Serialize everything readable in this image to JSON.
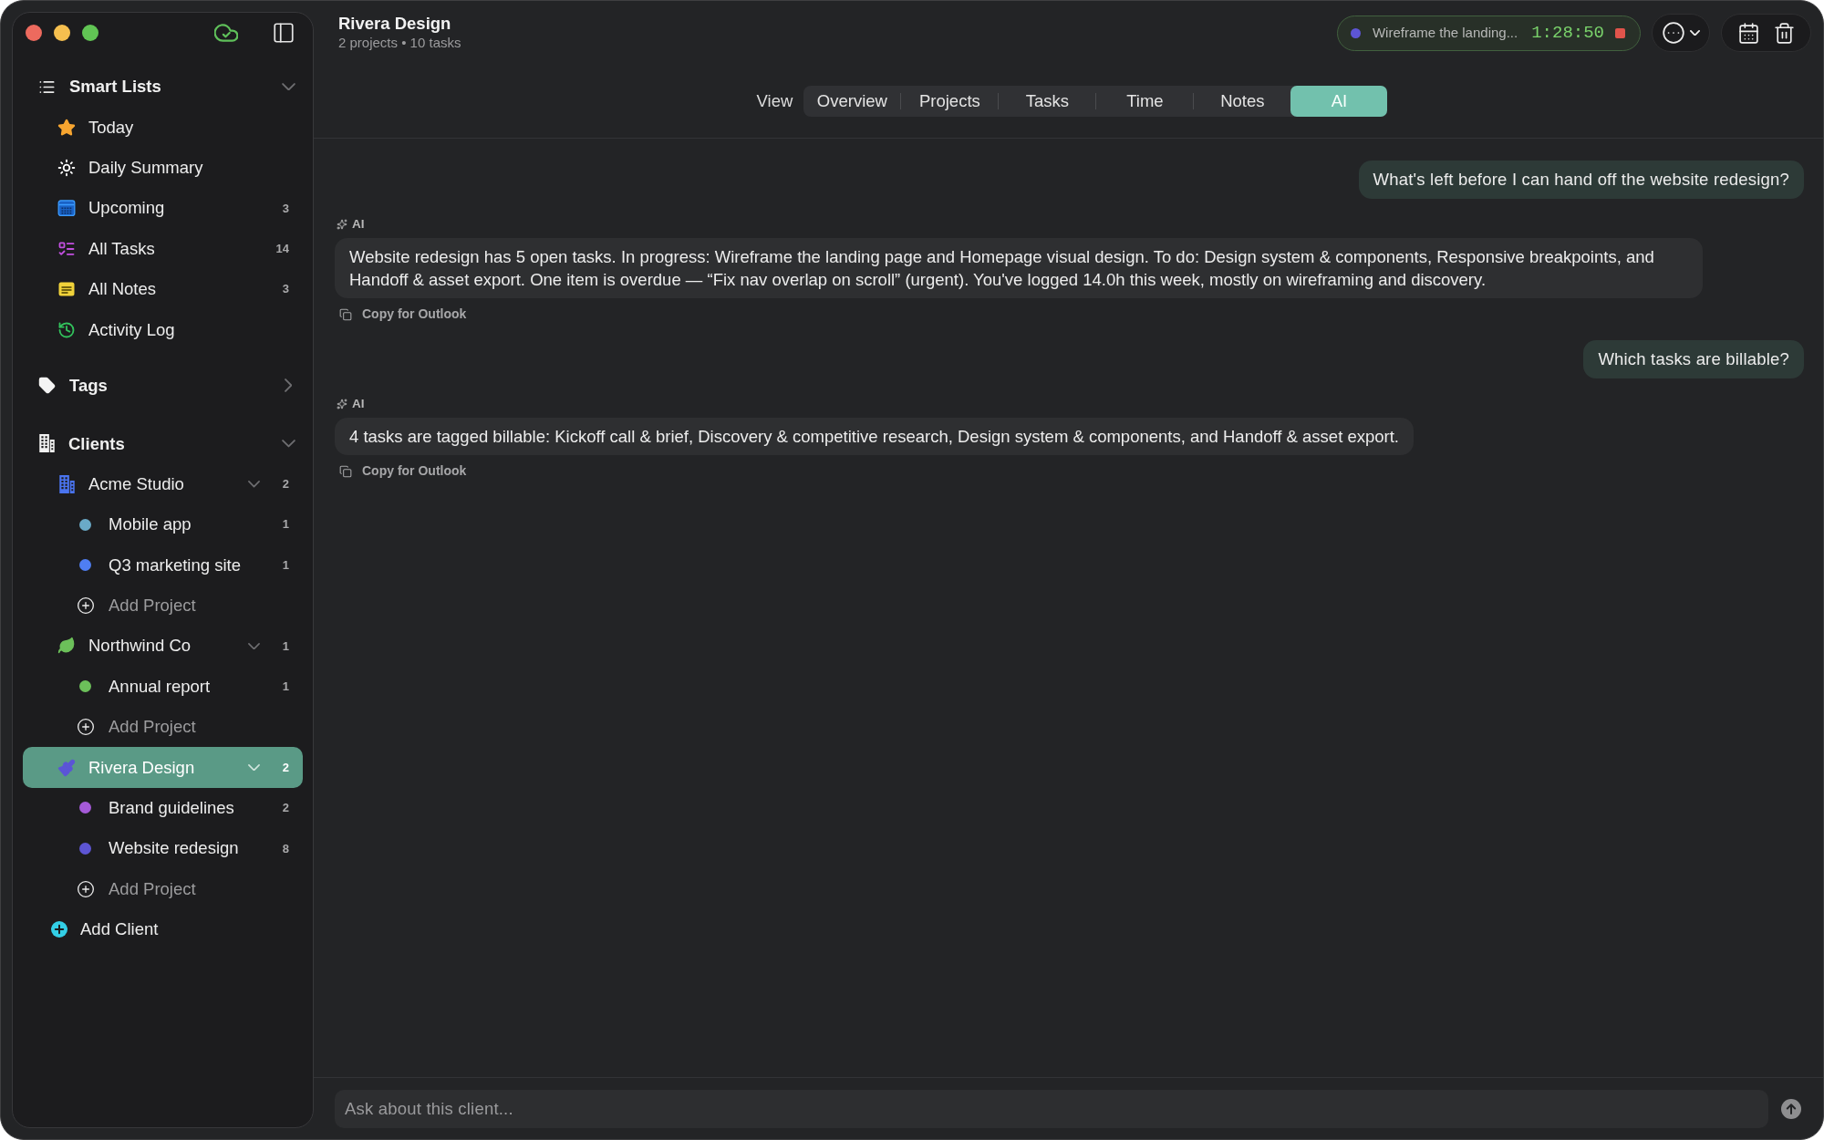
{
  "sidebar": {
    "smart_lists": {
      "title": "Smart Lists",
      "expanded": true,
      "items": [
        {
          "label": "Today",
          "selected": false
        },
        {
          "label": "Daily Summary",
          "selected": false
        },
        {
          "label": "Upcoming",
          "count": "3",
          "selected": false
        },
        {
          "label": "All Tasks",
          "count": "14",
          "selected": false
        },
        {
          "label": "All Notes",
          "count": "3",
          "selected": false
        },
        {
          "label": "Activity Log",
          "selected": false
        }
      ]
    },
    "tags": {
      "title": "Tags",
      "expanded": false
    },
    "clients": {
      "title": "Clients",
      "expanded": true,
      "items": [
        {
          "name": "Acme Studio",
          "count": "2",
          "expanded": true,
          "selected": false,
          "projects": [
            {
              "name": "Mobile app",
              "count": "1",
              "color": "#6aaac8",
              "selected": false
            },
            {
              "name": "Q3 marketing site",
              "count": "1",
              "color": "#4f7ef2",
              "selected": false
            }
          ],
          "add_project": "Add Project"
        },
        {
          "name": "Northwind Co",
          "count": "1",
          "expanded": true,
          "selected": false,
          "projects": [
            {
              "name": "Annual report",
              "count": "1",
              "color": "#6cc05a",
              "selected": false
            }
          ],
          "add_project": "Add Project"
        },
        {
          "name": "Rivera Design",
          "count": "2",
          "expanded": true,
          "selected": true,
          "projects": [
            {
              "name": "Brand guidelines",
              "count": "2",
              "color": "#a55ad8",
              "selected": false
            },
            {
              "name": "Website redesign",
              "count": "8",
              "color": "#5d55d4",
              "selected": false
            }
          ],
          "add_project": "Add Project"
        }
      ]
    },
    "add_client": "Add Client"
  },
  "header": {
    "title": "Rivera Design",
    "subtitle": "2 projects • 10 tasks"
  },
  "timer": {
    "task": "Wireframe the landing...",
    "elapsed": "1:28:50",
    "running": true
  },
  "view_tabs": {
    "label": "View",
    "tabs": [
      {
        "label": "Overview",
        "selected": false
      },
      {
        "label": "Projects",
        "selected": false
      },
      {
        "label": "Tasks",
        "selected": false
      },
      {
        "label": "Time",
        "selected": false
      },
      {
        "label": "Notes",
        "selected": false
      },
      {
        "label": "AI",
        "selected": true
      }
    ]
  },
  "messages": [
    {
      "kind": "user",
      "text": "What's left before I can hand off the website redesign?"
    },
    {
      "kind": "ai",
      "sender": "AI",
      "text": "Website redesign has 5 open tasks. In progress: Wireframe the landing page and Homepage visual design. To do: Design system & components, Responsive breakpoints, and Handoff & asset export. One item is overdue — “Fix nav overlap on scroll” (urgent). You've logged 14.0h this week, mostly on wireframing and discovery.",
      "action": "Copy for Outlook"
    },
    {
      "kind": "user",
      "text": "Which tasks are billable?"
    },
    {
      "kind": "ai",
      "sender": "AI",
      "text": "4 tasks are tagged billable: Kickoff call & brief, Discovery & competitive research, Design system & components, and Handoff & asset export.",
      "action": "Copy for Outlook"
    }
  ],
  "composer": {
    "placeholder": "Ask about this client..."
  }
}
